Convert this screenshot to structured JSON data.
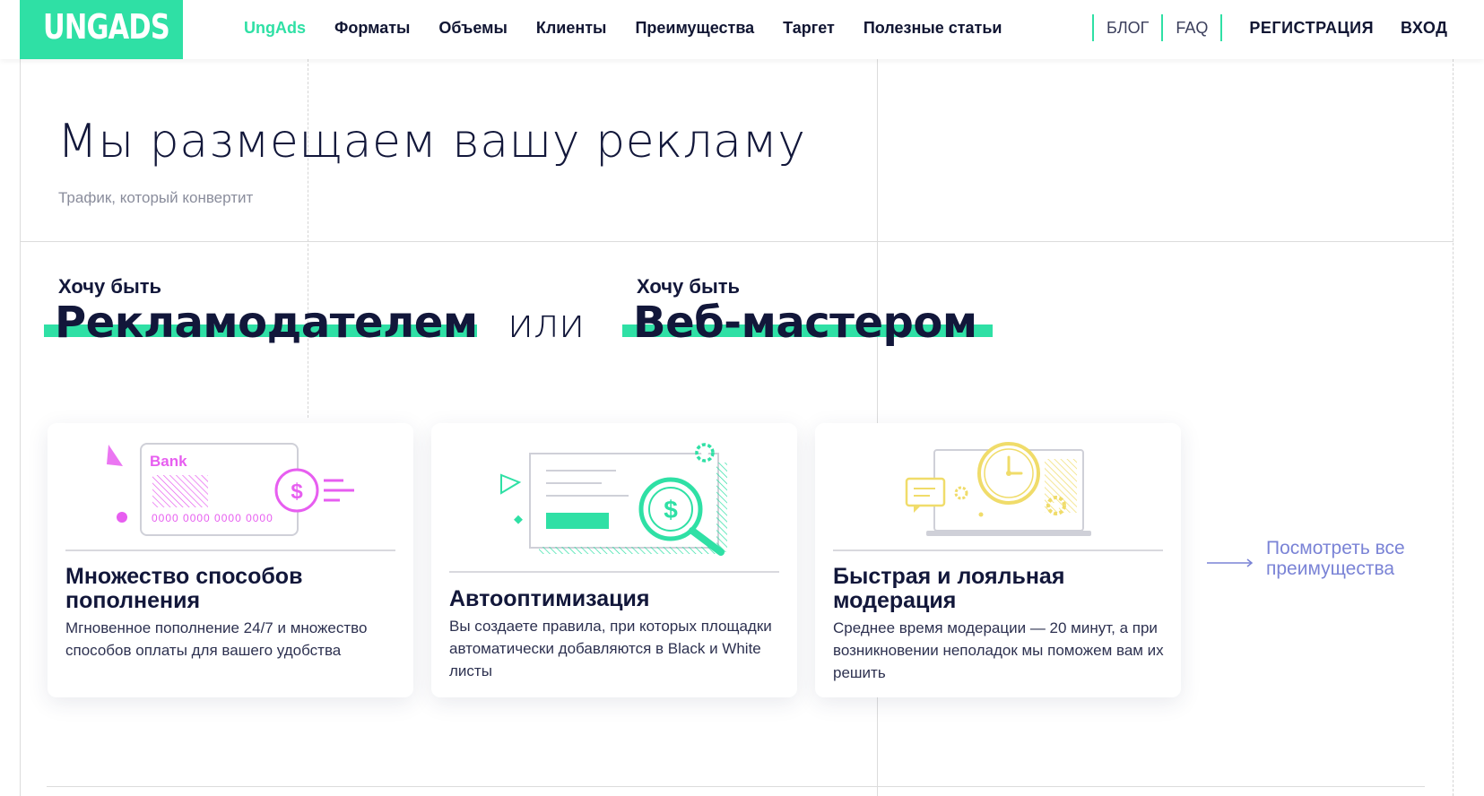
{
  "header": {
    "logo": "UNGADS",
    "nav": [
      "UngAds",
      "Форматы",
      "Объемы",
      "Клиенты",
      "Преимущества",
      "Таргет",
      "Полезные статьи"
    ],
    "blog": "БЛОГ",
    "faq": "FAQ",
    "register": "РЕГИСТРАЦИЯ",
    "login": "ВХОД"
  },
  "hero": {
    "title": "Мы размещаем вашу рекламу",
    "subtitle": "Трафик, который конвертит"
  },
  "choice": {
    "want1": "Хочу быть",
    "role1": "Рекламодателем",
    "or": "или",
    "want2": "Хочу быть",
    "role2": "Веб-мастером"
  },
  "cards": [
    {
      "bank_label": "Bank",
      "card_number": "0000 0000 0000 0000",
      "title": "Множество способов пополнения",
      "text": "Мгновенное пополнение 24/7 и множество способов оплаты для вашего удобства"
    },
    {
      "title": "Автооптимизация",
      "text": "Вы создаете правила, при которых площадки автоматически добавляются в Black и White листы"
    },
    {
      "title": "Быстрая и лояльная модерация",
      "text": "Среднее время модерации — 20 минут, а при возникновении неполадок мы поможем вам их решить"
    }
  ],
  "see_all": {
    "line1": "Посмотреть все",
    "line2": "преимущества"
  },
  "colors": {
    "accent": "#2fe0a5",
    "text_dark": "#12173a",
    "link": "#7a83d6",
    "pink": "#e75ef0",
    "yellow": "#f0dc6a"
  },
  "icons": {
    "card1": "bank-card-dollar-icon",
    "card2": "search-dollar-icon",
    "card3": "laptop-clock-icon",
    "see_all": "long-arrow-right-icon"
  }
}
